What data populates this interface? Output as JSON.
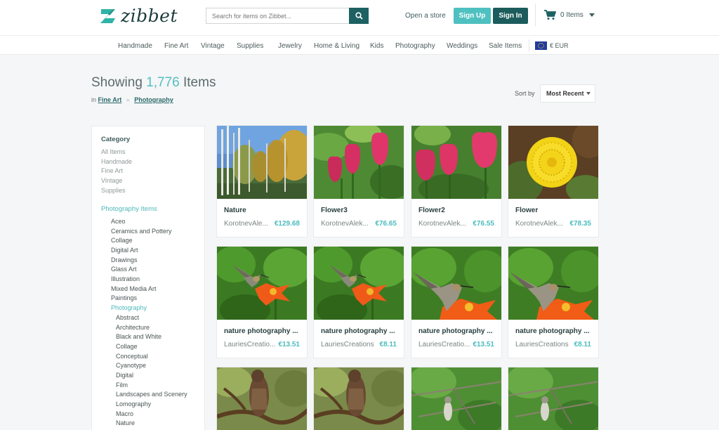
{
  "header": {
    "logo_text": "zibbet",
    "search_placeholder": "Search for items on Zibbet...",
    "open_store": "Open a store",
    "sign_up": "Sign Up",
    "sign_in": "Sign In",
    "cart_label": "0 Items"
  },
  "nav": {
    "items": [
      "Handmade",
      "Fine Art",
      "Vintage",
      "Supplies",
      "Jewelry",
      "Home & Living",
      "Kids",
      "Photography",
      "Weddings",
      "Sale Items"
    ],
    "currency": "€ EUR"
  },
  "listing": {
    "showing_prefix": "Showing",
    "count": "1,776",
    "showing_suffix": "Items",
    "crumb_in": "in",
    "crumb_1": "Fine Art",
    "crumb_sep": "»",
    "crumb_2": "Photography",
    "sort_label": "Sort by",
    "sort_value": "Most Recent"
  },
  "sidebar": {
    "category_heading": "Category",
    "categories": [
      "All Items",
      "Handmade",
      "Fine Art",
      "Vintage",
      "Supplies"
    ],
    "photo_heading": "Photography Items",
    "photo_items": [
      "Aceo",
      "Ceramics and Pottery",
      "Collage",
      "Digital Art",
      "Drawings",
      "Glass Art",
      "Illustration",
      "Mixed Media Art",
      "Paintings",
      "Photography"
    ],
    "sub_items": [
      "Abstract",
      "Architecture",
      "Black and White",
      "Collage",
      "Conceptual",
      "Cyanotype",
      "Digital",
      "Film",
      "Landscapes and Scenery",
      "Lomography",
      "Macro",
      "Nature"
    ]
  },
  "products": [
    {
      "title": "Nature",
      "seller": "KorotnevAle...",
      "price": "€129.68"
    },
    {
      "title": "Flower3",
      "seller": "KorotnevAlek...",
      "price": "€76.65"
    },
    {
      "title": "Flower2",
      "seller": "KorotnevAlek...",
      "price": "€76.55"
    },
    {
      "title": "Flower",
      "seller": "KorotnevAlek...",
      "price": "€78.35"
    },
    {
      "title": "nature photography ...",
      "seller": "LauriesCreatio...",
      "price": "€13.51"
    },
    {
      "title": "nature photography ...",
      "seller": "LauriesCreations",
      "price": "€8.11"
    },
    {
      "title": "nature photography ...",
      "seller": "LauriesCreatio...",
      "price": "€13.51"
    },
    {
      "title": "nature photography ...",
      "seller": "LauriesCreations",
      "price": "€8.11"
    }
  ],
  "colors": {
    "brand": "#1d6163",
    "accent": "#4fc0c0"
  }
}
